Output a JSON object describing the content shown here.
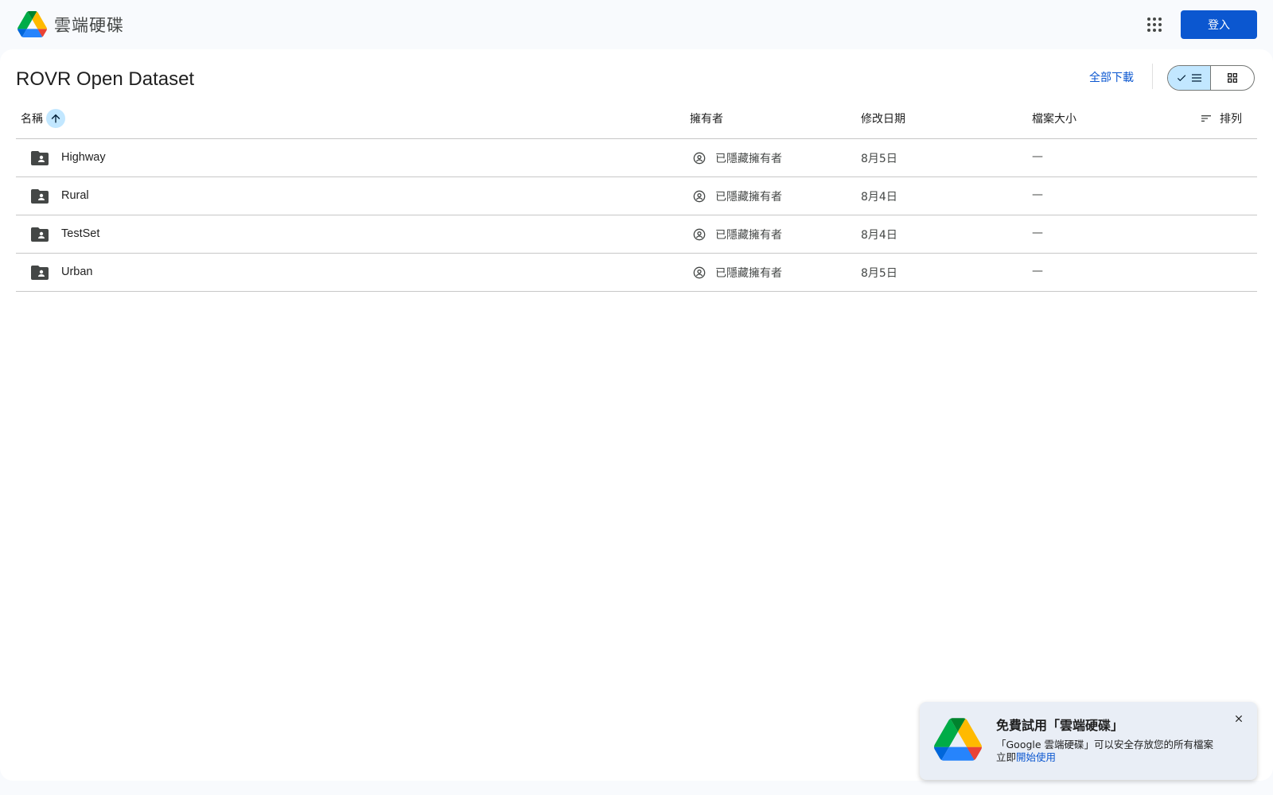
{
  "header": {
    "app_title": "雲端硬碟",
    "logo_icon": "google-drive-logo",
    "apps_icon": "apps-grid-icon",
    "signin_label": "登入"
  },
  "folder": {
    "title": "ROVR Open Dataset",
    "download_all_label": "全部下載",
    "view_modes": [
      "list",
      "grid"
    ],
    "active_view": "list"
  },
  "columns": {
    "name": "名稱",
    "owner": "擁有者",
    "modified": "修改日期",
    "size": "檔案大小",
    "sort_label": "排列",
    "sort_direction": "ascending"
  },
  "files": [
    {
      "name": "Highway",
      "owner": "已隱藏擁有者",
      "modified": "8月5日",
      "size": "—"
    },
    {
      "name": "Rural",
      "owner": "已隱藏擁有者",
      "modified": "8月4日",
      "size": "—"
    },
    {
      "name": "TestSet",
      "owner": "已隱藏擁有者",
      "modified": "8月4日",
      "size": "—"
    },
    {
      "name": "Urban",
      "owner": "已隱藏擁有者",
      "modified": "8月5日",
      "size": "—"
    }
  ],
  "promo": {
    "title": "免費試用「雲端硬碟」",
    "body_line1": "「Google 雲端硬碟」可以安全存放您的所有檔案",
    "body_prefix": "立即",
    "link_label": "開始使用"
  },
  "colors": {
    "accent": "#0b57d0",
    "selected_bg": "#c2e7ff",
    "page_bg": "#f8fafd",
    "promo_bg": "#e9eef6"
  }
}
